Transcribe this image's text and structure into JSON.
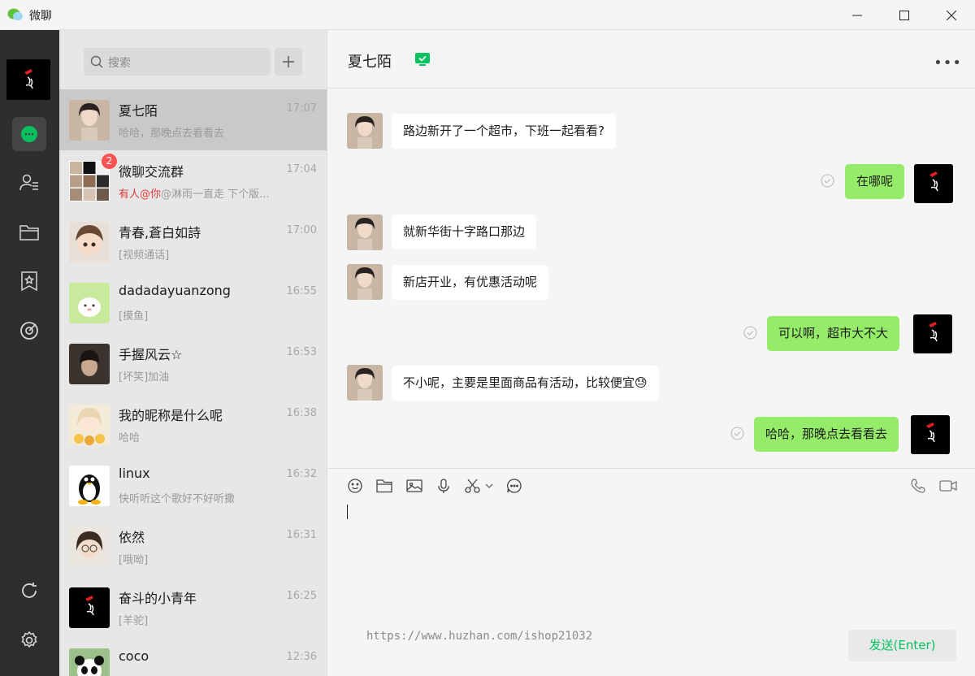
{
  "window": {
    "title": "微聊"
  },
  "search": {
    "placeholder": "搜索"
  },
  "conversations": [
    {
      "name": "夏七陌",
      "time": "17:07",
      "preview": "哈哈，那晚点去看看去",
      "selected": true
    },
    {
      "name": "微聊交流群",
      "time": "17:04",
      "mention": "有人@你",
      "preview": "@淋雨一直走 下个版...",
      "badge": "2"
    },
    {
      "name": "青春,蒼白如詩",
      "time": "17:00",
      "preview": "[视频通话]"
    },
    {
      "name": "dadadayuanzong",
      "time": "16:55",
      "preview": "[摸鱼]"
    },
    {
      "name": "手握风云☆",
      "time": "16:53",
      "preview": "[坏笑]加油"
    },
    {
      "name": "我的昵称是什么呢",
      "time": "16:38",
      "preview": "哈哈"
    },
    {
      "name": "linux",
      "time": "16:32",
      "preview": "快听听这个歌好不好听撒"
    },
    {
      "name": "依然",
      "time": "16:31",
      "preview": "[哦呦]"
    },
    {
      "name": "奋斗的小青年",
      "time": "16:25",
      "preview": "[羊驼]"
    },
    {
      "name": "coco",
      "time": "12:36",
      "preview": ""
    }
  ],
  "chat": {
    "title": "夏七陌",
    "messages": [
      {
        "direction": "in",
        "text": "路边新开了一个超市，下班一起看看?"
      },
      {
        "direction": "out",
        "text": "在哪呢"
      },
      {
        "direction": "in",
        "text": "就新华街十字路口那边"
      },
      {
        "direction": "in",
        "text": "新店开业，有优惠活动呢"
      },
      {
        "direction": "out",
        "text": "可以啊，超市大不大"
      },
      {
        "direction": "in",
        "text": "不小呢，主要是里面商品有活动，比较便宜",
        "emoji": "😓"
      },
      {
        "direction": "out",
        "text": "哈哈，那晚点去看看去"
      }
    ]
  },
  "input": {
    "watermark": "https://www.huzhan.com/ishop21032",
    "send_label": "发送(Enter)"
  },
  "colors": {
    "accent": "#07c160",
    "bubble_out": "#95ec69",
    "nav_bg": "#2e2e2e"
  }
}
